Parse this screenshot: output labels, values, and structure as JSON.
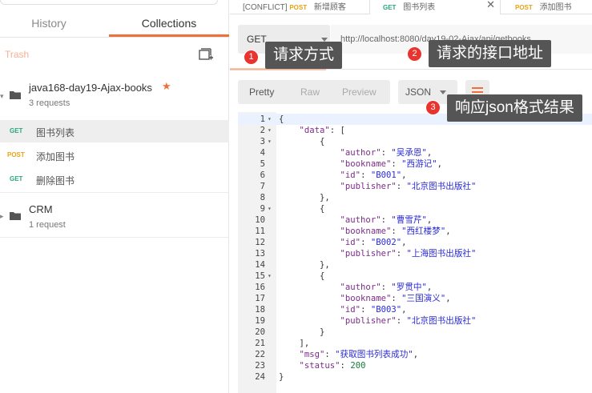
{
  "sidebar": {
    "tabs": [
      {
        "label": "History"
      },
      {
        "label": "Collections"
      }
    ],
    "trash_label": "Trash",
    "collections": [
      {
        "name": "java168-day19-Ajax-books",
        "sub": "3 requests",
        "requests": [
          {
            "method": "GET",
            "name": "图书列表"
          },
          {
            "method": "POST",
            "name": "添加图书"
          },
          {
            "method": "GET",
            "name": "删除图书"
          }
        ]
      },
      {
        "name": "CRM",
        "sub": "1 request"
      }
    ]
  },
  "tabs": [
    {
      "method": "[CONFLICT] POST",
      "prefix": "[CONFLICT]",
      "method_only": "POST",
      "name": "新增顾客"
    },
    {
      "method": "GET",
      "name": "图书列表"
    },
    {
      "method": "POST",
      "name": "添加图书"
    }
  ],
  "request": {
    "method": "GET",
    "url": "http://localhost:8080/day19-02-Ajax/api/getbooks"
  },
  "response": {
    "formats": [
      "Pretty",
      "Raw",
      "Preview"
    ],
    "language": "JSON"
  },
  "code": {
    "lines": [
      "{",
      "    \"data\": [",
      "        {",
      "            \"author\": \"吴承恩\",",
      "            \"bookname\": \"西游记\",",
      "            \"id\": \"B001\",",
      "            \"publisher\": \"北京图书出版社\"",
      "        },",
      "        {",
      "            \"author\": \"曹雪芹\",",
      "            \"bookname\": \"西红楼梦\",",
      "            \"id\": \"B002\",",
      "            \"publisher\": \"上海图书出版社\"",
      "        },",
      "        {",
      "            \"author\": \"罗贯中\",",
      "            \"bookname\": \"三国演义\",",
      "            \"id\": \"B003\",",
      "            \"publisher\": \"北京图书出版社\"",
      "        }",
      "    ],",
      "    \"msg\": \"获取图书列表成功\",",
      "    \"status\": 200",
      "}"
    ],
    "fold_lines": [
      1,
      2,
      3,
      9,
      15
    ]
  },
  "callouts": [
    {
      "num": "1",
      "text": "请求方式"
    },
    {
      "num": "2",
      "text": "请求的接口地址"
    },
    {
      "num": "3",
      "text": "响应json格式结果"
    }
  ],
  "colors": {
    "accent": "#f0703a",
    "get": "#2aa67a",
    "post": "#e8a317",
    "callout_badge": "#e8332e",
    "callout_bg": "#555555"
  }
}
